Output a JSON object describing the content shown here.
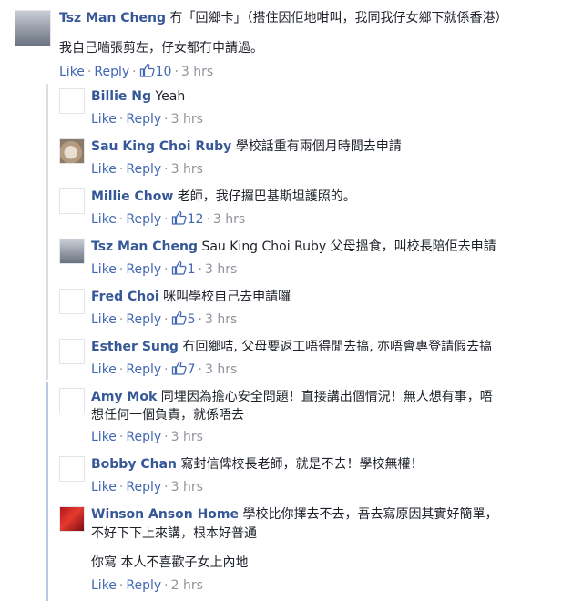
{
  "comments": [
    {
      "name": "Tsz Man Cheng",
      "text": "冇「回鄉卡」（搭住因佢地咁叫，我同我仔女鄉下就係香港）",
      "text2": "我自己嚙張剪左，仔女都冇申請過。",
      "actions": {
        "like": "Like",
        "reply": "Reply",
        "likes": "10",
        "time": "3 hrs"
      }
    },
    {
      "name": "Billie Ng",
      "text": "Yeah",
      "actions": {
        "like": "Like",
        "reply": "Reply",
        "time": "3 hrs"
      }
    },
    {
      "name": "Sau King Choi Ruby",
      "text": "學校話重有兩個月時間去申請",
      "actions": {
        "like": "Like",
        "reply": "Reply",
        "time": "3 hrs"
      }
    },
    {
      "name": "Millie Chow",
      "text": "老師，我仔攞巴基斯坦護照的。",
      "actions": {
        "like": "Like",
        "reply": "Reply",
        "likes": "12",
        "time": "3 hrs"
      }
    },
    {
      "name": "Tsz Man Cheng",
      "text": "Sau King Choi Ruby 父母搵食，叫校長陪佢去申請",
      "actions": {
        "like": "Like",
        "reply": "Reply",
        "likes": "1",
        "time": "3 hrs"
      }
    },
    {
      "name": "Fred Choi",
      "text": "咪叫學校自己去申請囉",
      "actions": {
        "like": "Like",
        "reply": "Reply",
        "likes": "5",
        "time": "3 hrs"
      }
    },
    {
      "name": "Esther Sung",
      "text": "冇回鄉咭, 父母要返工唔得閒去搞, 亦唔會專登請假去搞",
      "actions": {
        "like": "Like",
        "reply": "Reply",
        "likes": "7",
        "time": "3 hrs"
      }
    },
    {
      "name": "Amy Mok",
      "text": "同埋因為擔心安全問題！直接講出個情況！無人想有事，唔",
      "text2": "想任何一個負責，就係唔去",
      "actions": {
        "like": "Like",
        "reply": "Reply",
        "time": "3 hrs"
      }
    },
    {
      "name": "Bobby Chan",
      "text": "寫封信俾校長老師，就是不去！學校無權！",
      "actions": {
        "like": "Like",
        "reply": "Reply",
        "time": "3 hrs"
      }
    },
    {
      "name": "Winson Anson Home",
      "text": "學校比你擇去不去，吾去寫原因其實好簡單，",
      "text2": "不好下下上來講，根本好普通",
      "text3": "你寫 本人不喜歡子女上內地",
      "actions": {
        "like": "Like",
        "reply": "Reply",
        "time": "2 hrs"
      }
    }
  ],
  "colors": {
    "name": "#365899",
    "link": "#4267b2",
    "meta": "#90949c",
    "text": "#1d2129"
  }
}
